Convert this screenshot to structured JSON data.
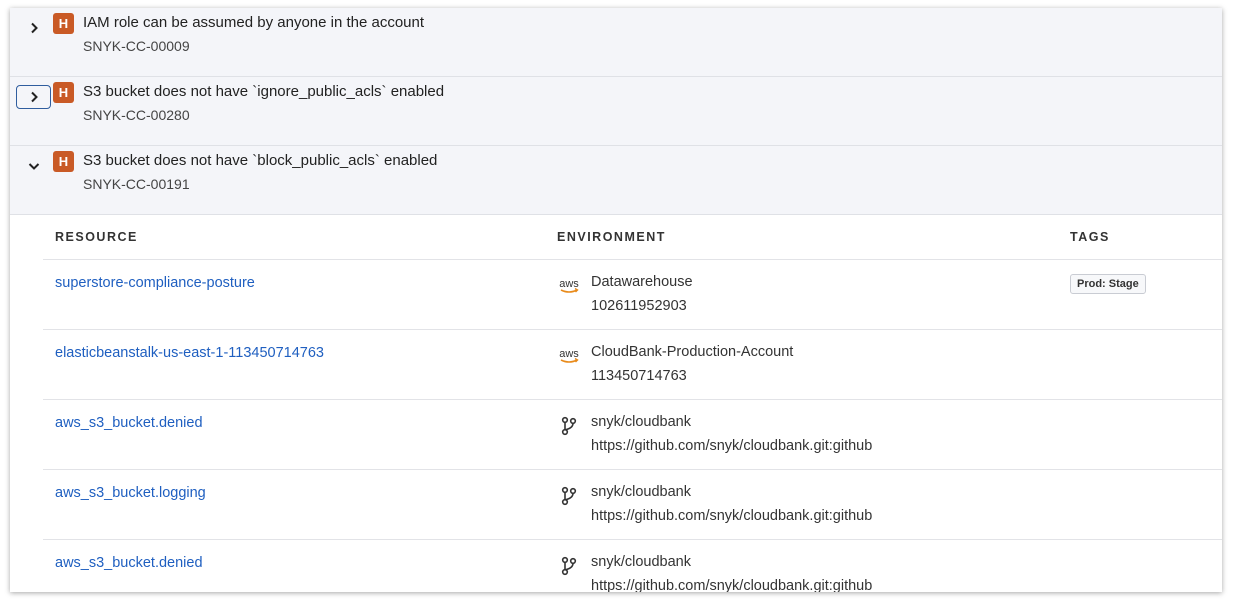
{
  "issues": [
    {
      "severity": "H",
      "title": "IAM role can be assumed by anyone in the account",
      "id": "SNYK-CC-00009",
      "expanded": false,
      "focused": false
    },
    {
      "severity": "H",
      "title": "S3 bucket does not have `ignore_public_acls` enabled",
      "id": "SNYK-CC-00280",
      "expanded": false,
      "focused": true
    },
    {
      "severity": "H",
      "title": "S3 bucket does not have `block_public_acls` enabled",
      "id": "SNYK-CC-00191",
      "expanded": true,
      "focused": false
    }
  ],
  "table": {
    "headers": {
      "resource": "RESOURCE",
      "environment": "ENVIRONMENT",
      "tags": "TAGS"
    },
    "rows": [
      {
        "resource": "superstore-compliance-posture",
        "env_icon": "aws-icon",
        "env_name": "Datawarehouse",
        "env_sub": "102611952903",
        "tag": "Prod: Stage"
      },
      {
        "resource": "elasticbeanstalk-us-east-1-113450714763",
        "env_icon": "aws-icon",
        "env_name": "CloudBank-Production-Account",
        "env_sub": "113450714763",
        "tag": ""
      },
      {
        "resource": "aws_s3_bucket.denied",
        "env_icon": "git-branch-icon",
        "env_name": "snyk/cloudbank",
        "env_sub": "https://github.com/snyk/cloudbank.git:github",
        "tag": ""
      },
      {
        "resource": "aws_s3_bucket.logging",
        "env_icon": "git-branch-icon",
        "env_name": "snyk/cloudbank",
        "env_sub": "https://github.com/snyk/cloudbank.git:github",
        "tag": ""
      },
      {
        "resource": "aws_s3_bucket.denied",
        "env_icon": "git-branch-icon",
        "env_name": "snyk/cloudbank",
        "env_sub": "https://github.com/snyk/cloudbank.git:github",
        "tag": ""
      }
    ]
  },
  "icons": {
    "aws_label": "aws"
  },
  "colors": {
    "severity_high": "#c95a26",
    "link": "#1f5fc0",
    "focus": "#2f5d9e"
  }
}
